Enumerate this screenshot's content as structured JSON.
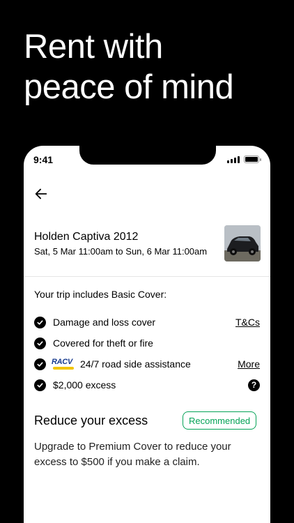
{
  "headline": {
    "line1": "Rent with",
    "line2": "peace of mind"
  },
  "status_bar": {
    "time": "9:41"
  },
  "booking": {
    "car_name": "Holden Captiva 2012",
    "dates": "Sat, 5 Mar 11:00am to Sun, 6 Mar 11:00am"
  },
  "cover": {
    "heading": "Your trip includes Basic Cover:",
    "items": [
      {
        "label": "Damage and loss cover",
        "link": "T&Cs"
      },
      {
        "label": "Covered for theft or fire"
      },
      {
        "label": "24/7 road side assistance",
        "link": "More",
        "logo_text": "RACV"
      },
      {
        "label": "$2,000 excess",
        "help": "?"
      }
    ]
  },
  "upgrade": {
    "title": "Reduce your excess",
    "badge": "Recommended",
    "description": "Upgrade to Premium Cover to reduce your excess to $500 if you make a claim."
  },
  "colors": {
    "recommended": "#05a357",
    "racv_blue": "#1a3d8f",
    "racv_yellow": "#f2c500"
  },
  "icons": [
    "back-arrow-icon",
    "check-circle-icon",
    "help-circle-icon",
    "signal-icon",
    "battery-icon"
  ]
}
